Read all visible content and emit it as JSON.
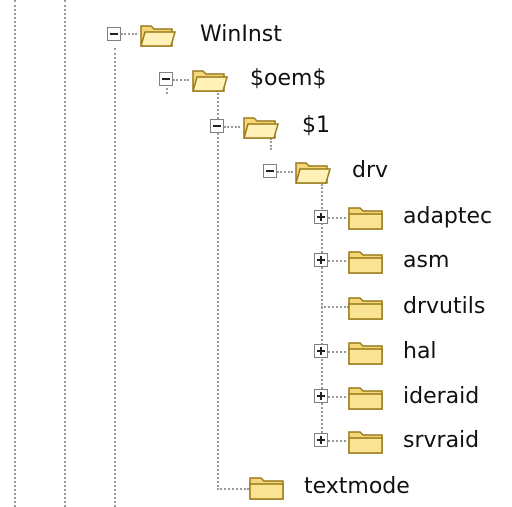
{
  "tree": {
    "nodes": [
      {
        "label": "WinInst",
        "icon": "folder-open-icon",
        "expander": "expanded"
      },
      {
        "label": "$oem$",
        "icon": "folder-open-icon",
        "expander": "expanded"
      },
      {
        "label": "$1",
        "icon": "folder-open-icon",
        "expander": "expanded"
      },
      {
        "label": "drv",
        "icon": "folder-open-icon",
        "expander": "expanded"
      },
      {
        "label": "adaptec",
        "icon": "folder-closed-icon",
        "expander": "collapsed"
      },
      {
        "label": "asm",
        "icon": "folder-closed-icon",
        "expander": "collapsed"
      },
      {
        "label": "drvutils",
        "icon": "folder-closed-icon",
        "expander": "none"
      },
      {
        "label": "hal",
        "icon": "folder-closed-icon",
        "expander": "collapsed"
      },
      {
        "label": "ideraid",
        "icon": "folder-closed-icon",
        "expander": "collapsed"
      },
      {
        "label": "srvraid",
        "icon": "folder-closed-icon",
        "expander": "collapsed"
      },
      {
        "label": "textmode",
        "icon": "folder-closed-icon",
        "expander": "none"
      }
    ]
  },
  "colors": {
    "folder_fill": "#f5d77a",
    "folder_light": "#fff1b8",
    "folder_outline": "#9a7a1a",
    "connector": "#9a9a9a"
  }
}
